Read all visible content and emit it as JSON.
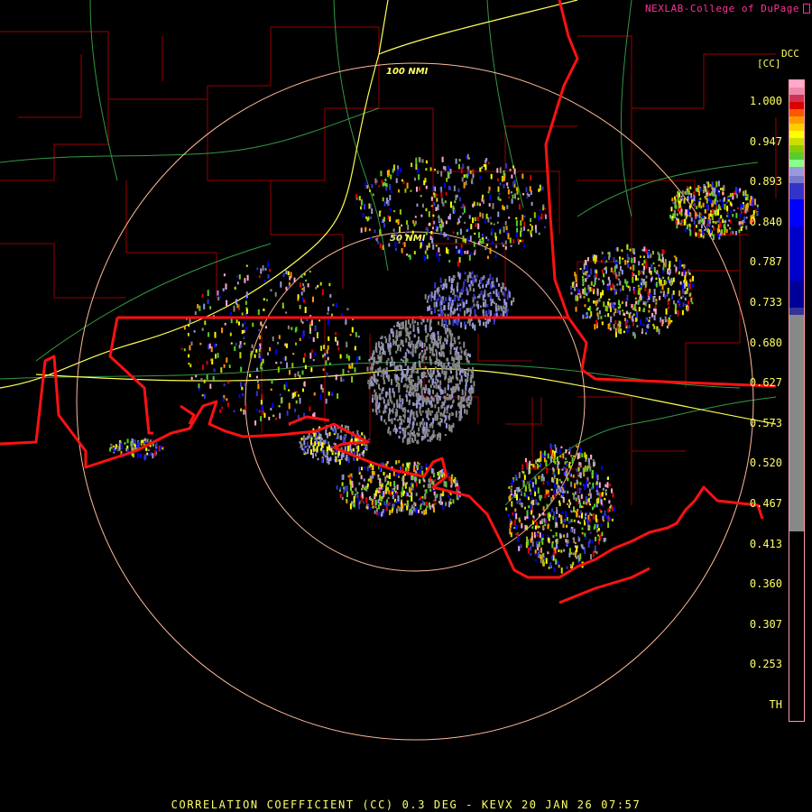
{
  "credit": "NEXLAB-College of DuPage",
  "station_label": "DCC",
  "product_label": "[CC]",
  "range_rings": [
    {
      "label": "100 NMI"
    },
    {
      "label": "50 NMI"
    }
  ],
  "legend": {
    "ticks": [
      "1.000",
      "0.947",
      "0.893",
      "0.840",
      "0.787",
      "0.733",
      "0.680",
      "0.627",
      "0.573",
      "0.520",
      "0.467",
      "0.413",
      "0.360",
      "0.307",
      "0.253",
      "TH"
    ],
    "colors": [
      "#ffaacc",
      "#ee88aa",
      "#cc3355",
      "#dd0000",
      "#ff5500",
      "#ff9900",
      "#ffcc00",
      "#ffff00",
      "#ccdd00",
      "#88cc00",
      "#55cc33",
      "#88ff88",
      "#9999dd",
      "#7777cc",
      "#3333cc",
      "#0000ff",
      "#0000cc",
      "#000099",
      "#333399",
      "#888888",
      "#000000"
    ]
  },
  "caption": "CORRELATION COEFFICIENT (CC) 0.3 DEG - KEVX 20 JAN 26 07:57"
}
